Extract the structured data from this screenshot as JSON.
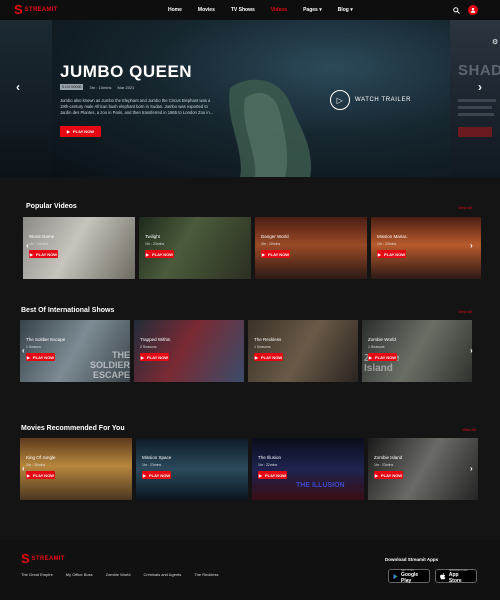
{
  "brand": {
    "letter": "S",
    "name": "STREAMIT"
  },
  "nav": {
    "items": [
      "Home",
      "Movies",
      "TV Shows",
      "Videos",
      "Pages",
      "Blog"
    ],
    "active_index": 3
  },
  "hero": {
    "title": "JUMBO QUEEN",
    "badge": "5.1/0.0/0000",
    "duration": "3hr : 10mins",
    "date": "Mar 2021",
    "description": "Jumbo also known as Jumbo the Elephant and Jumbo the Circus Elephant was a 19th-century male African bush elephant born in Sudan. Jumbo was exported to Jardin des Plantes, a zoo in Paris, and then transferred in 1865 to London Zoo in...",
    "play_label": "PLAY NOW",
    "watch_label": "WATCH TRAILER",
    "next_title": "SHAD"
  },
  "sections": [
    {
      "title": "Popular Videos",
      "view_all": "View All",
      "cards": [
        {
          "title": "Worst Game",
          "meta": "1hr : 44mins",
          "play": "PLAY NOW",
          "bg": "linear-gradient(120deg,#8b8b86 0%,#c7c4bd 45%,#6e6a62 100%)"
        },
        {
          "title": "Twilight",
          "meta": "1hr : 23mins",
          "play": "PLAY NOW",
          "bg": "linear-gradient(120deg,#1e2a1d 0%,#4b5b3b 40%,#2a2f22 100%)"
        },
        {
          "title": "Danger World",
          "meta": "3hr : 10mins",
          "play": "PLAY NOW",
          "bg": "linear-gradient(180deg,#4a1e14 0%,#9a4a26 45%,#2c1a16 100%)"
        },
        {
          "title": "Mission Mariar..",
          "meta": "1hr : 23mins",
          "play": "PLAY NOW",
          "bg": "linear-gradient(180deg,#4a1e14 0%,#b85a2c 45%,#2c1a16 100%)"
        }
      ]
    },
    {
      "title": "Best Of International Shows",
      "view_all": "View All",
      "cards": [
        {
          "title": "The Soldier Escape",
          "meta": "1 Season",
          "play": "PLAY NOW",
          "bg": "linear-gradient(120deg,#36424a 0%,#7d8c94 50%,#3b444a 100%)",
          "overlay": "THE SOLDIER ESCAPE"
        },
        {
          "title": "Trapped Within",
          "meta": "2 Seasons",
          "play": "PLAY NOW",
          "bg": "linear-gradient(120deg,#222c3a 0%,#7a2a33 45%,#3a4c6a 100%)"
        },
        {
          "title": "The Reckless",
          "meta": "1 Seasons",
          "play": "PLAY NOW",
          "bg": "linear-gradient(120deg,#3a3128 0%,#6a5a48 50%,#2a2420 100%)"
        },
        {
          "title": "Zombie World",
          "meta": "1 Seasons",
          "play": "PLAY NOW",
          "bg": "linear-gradient(120deg,#2a2f2c 0%,#6a6f66 50%,#2e322c 100%)",
          "overlay": "Zombie Island"
        }
      ]
    },
    {
      "title": "Movies Recommended For You",
      "view_all": "View All",
      "cards": [
        {
          "title": "King Of Jungle",
          "meta": "2hr : 30mins",
          "play": "PLAY NOW",
          "bg": "linear-gradient(180deg,#5c3b1c 0%,#b8873e 45%,#4a3620 100%)"
        },
        {
          "title": "Mission Space",
          "meta": "1hr : 23mins",
          "play": "PLAY NOW",
          "bg": "linear-gradient(180deg,#0e1b27 0%,#2b4a5c 50%,#0c1620 100%)"
        },
        {
          "title": "The Illusion",
          "meta": "1hr : 22mins",
          "play": "PLAY NOW",
          "bg": "linear-gradient(180deg,#0a0c1a 0%,#1e2450 50%,#3a0c14 100%)",
          "overlay": "THE ILLUSION"
        },
        {
          "title": "Zombie Island",
          "meta": "1hr : 23mins",
          "play": "PLAY NOW",
          "bg": "linear-gradient(120deg,#1a1a1a 0%,#6a6a66 50%,#242424 100%)"
        }
      ]
    }
  ],
  "footer": {
    "links": [
      "The Great Empire",
      "My Office Boss",
      "Zombie World",
      "Criminals and Agents",
      "The Reckless"
    ],
    "apps_title": "Download Streamit Apps",
    "google": {
      "small": "GET IT ON",
      "big": "Google Play"
    },
    "apple": {
      "small": "Download on the",
      "big": "App Store"
    }
  },
  "colors": {
    "accent": "#e50914",
    "background": "#141414"
  }
}
